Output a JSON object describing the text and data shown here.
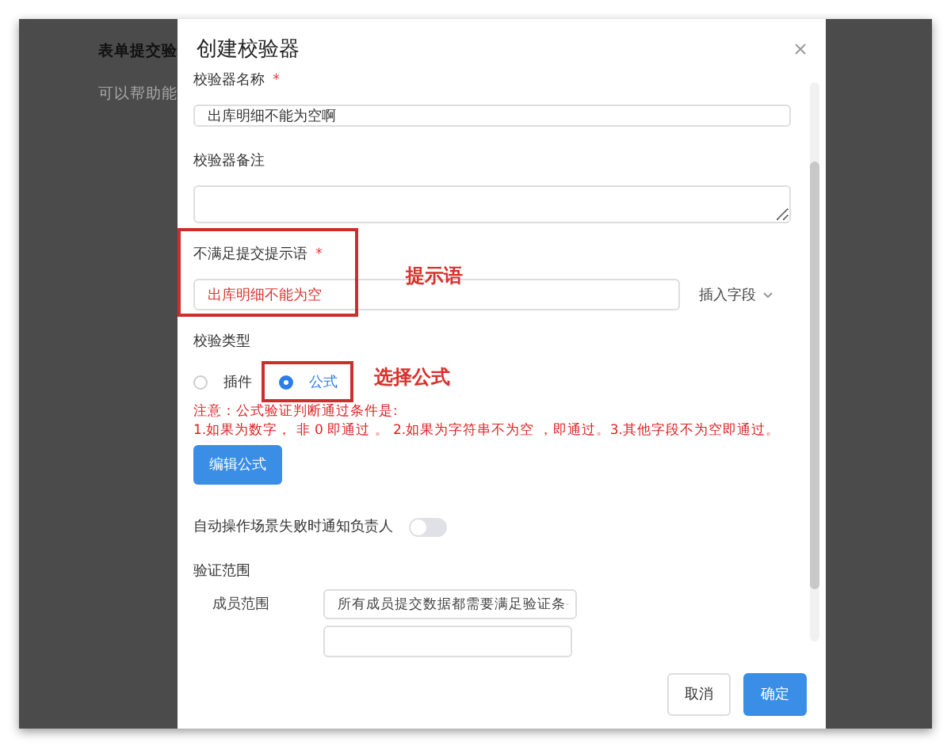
{
  "background": {
    "title": "表单提交验",
    "description": "可以帮助能"
  },
  "dialog": {
    "title": "创建校验器",
    "name_field": {
      "label": "校验器名称",
      "required_mark": "*",
      "value": "出库明细不能为空啊"
    },
    "remark_field": {
      "label": "校验器备注"
    },
    "message_field": {
      "label": "不满足提交提示语",
      "required_mark": "*",
      "value": "出库明细不能为空",
      "insert_label": "插入字段",
      "annotation": "提示语"
    },
    "type_group": {
      "label": "校验类型",
      "annotation": "选择公式",
      "options": [
        {
          "label": "插件",
          "selected": false
        },
        {
          "label": "公式",
          "selected": true
        }
      ]
    },
    "note": [
      "注意：公式验证判断通过条件是:",
      "1.如果为数字， 非 0 即通过 。 2.如果为字符串不为空 ，即通过。3.其他字段不为空即通过。"
    ],
    "edit_button": "编辑公式",
    "notify_toggle": {
      "label": "自动操作场景失败时通知负责人",
      "on": false
    },
    "scope": {
      "label": "验证范围",
      "rows": [
        {
          "label": "成员范围",
          "value": "所有成员提交数据都需要满足验证条"
        }
      ]
    },
    "buttons": [
      {
        "label": "取消",
        "kind": "secondary"
      },
      {
        "label": "确定",
        "kind": "primary"
      }
    ]
  }
}
